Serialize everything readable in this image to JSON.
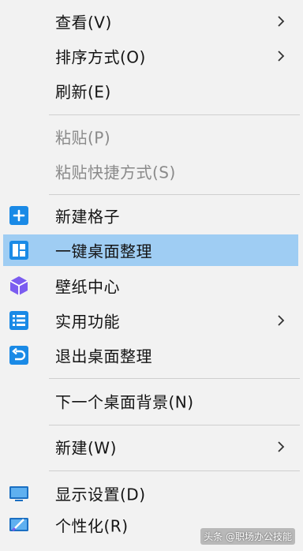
{
  "menu": {
    "items": [
      {
        "label": "查看(V)",
        "submenu": true
      },
      {
        "label": "排序方式(O)",
        "submenu": true
      },
      {
        "label": "刷新(E)"
      },
      {
        "label": "粘贴(P)",
        "disabled": true
      },
      {
        "label": "粘贴快捷方式(S)",
        "disabled": true
      },
      {
        "label": "新建格子",
        "icon": "plus-square-icon"
      },
      {
        "label": "一键桌面整理",
        "icon": "layout-grid-icon",
        "highlighted": true
      },
      {
        "label": "壁纸中心",
        "icon": "cube-icon"
      },
      {
        "label": "实用功能",
        "icon": "list-icon",
        "submenu": true
      },
      {
        "label": "退出桌面整理",
        "icon": "undo-icon"
      },
      {
        "label": "下一个桌面背景(N)"
      },
      {
        "label": "新建(W)",
        "submenu": true
      },
      {
        "label": "显示设置(D)",
        "icon": "monitor-icon"
      },
      {
        "label": "个性化(R)",
        "icon": "personalize-icon"
      }
    ]
  },
  "watermark": "头条 @职场办公技能",
  "colors": {
    "menu_bg": "#f2f2f2",
    "highlight": "#9fcdf3",
    "icon_blue": "#1a8ae6",
    "icon_purple": "#7b5cf0",
    "disabled_text": "#8a8a8a"
  }
}
